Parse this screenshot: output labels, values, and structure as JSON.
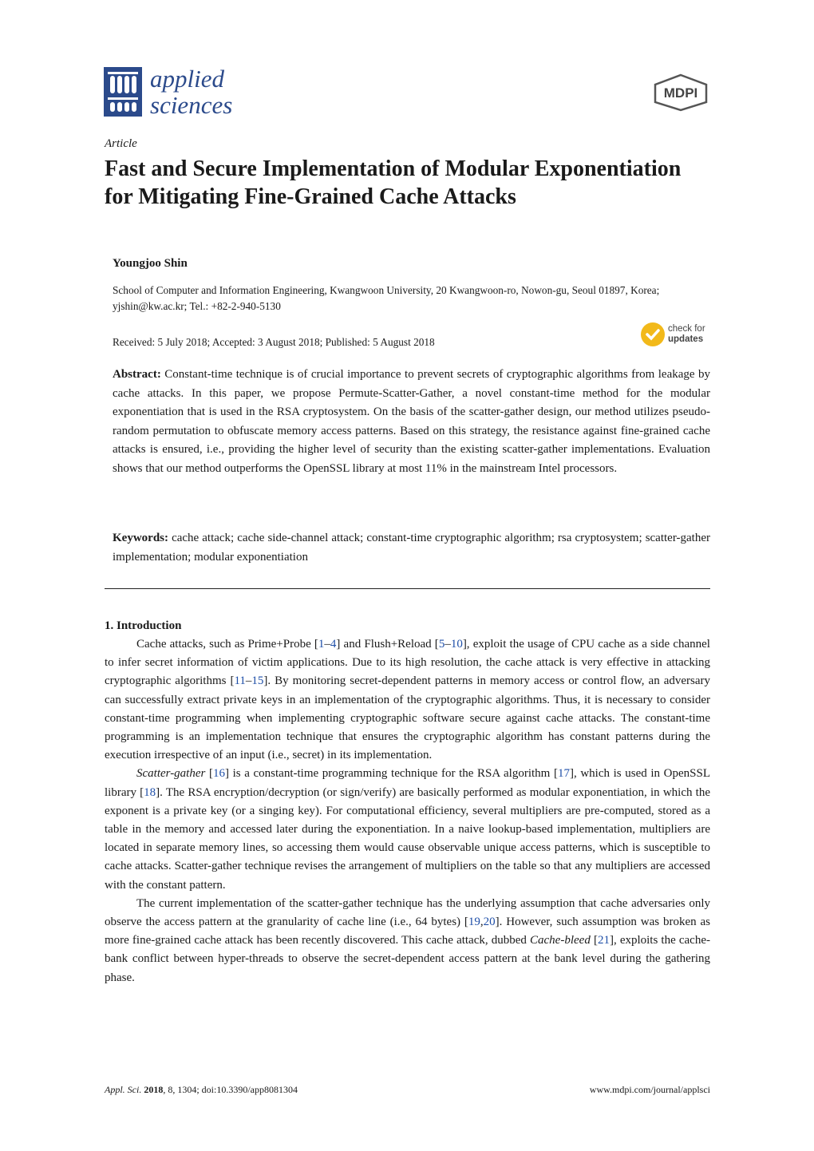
{
  "header": {
    "journal_line1": "applied",
    "journal_line2": "sciences",
    "publisher": "MDPI",
    "colors": {
      "journal_blue": "#2b4a8b",
      "link_blue": "#1f4fa8",
      "check_yellow": "#f2b91a"
    }
  },
  "article": {
    "type": "Article",
    "title": "Fast and Secure Implementation of Modular Exponentiation for Mitigating Fine-Grained Cache Attacks",
    "author": "Youngjoo Shin",
    "affiliation": "School of Computer and Information Engineering, Kwangwoon University, 20 Kwangwoon-ro, Nowon-gu, Seoul 01897, Korea; yjshin@kw.ac.kr; Tel.: +82-2-940-5130",
    "dates": "Received: 5 July 2018; Accepted: 3 August 2018; Published: 5 August 2018",
    "check_updates": {
      "line1": "check for",
      "line2": "updates"
    }
  },
  "abstract": {
    "label": "Abstract:",
    "text": "Constant-time technique is of crucial importance to prevent secrets of cryptographic algorithms from leakage by cache attacks. In this paper, we propose Permute-Scatter-Gather, a novel constant-time method for the modular exponentiation that is used in the RSA cryptosystem. On the basis of the scatter-gather design, our method utilizes pseudo-random permutation to obfuscate memory access patterns. Based on this strategy, the resistance against fine-grained cache attacks is ensured, i.e., providing the higher level of security than the existing scatter-gather implementations. Evaluation shows that our method outperforms the OpenSSL library at most 11% in the mainstream Intel processors."
  },
  "keywords": {
    "label": "Keywords:",
    "text": "cache attack; cache side-channel attack; constant-time cryptographic algorithm; rsa cryptosystem; scatter-gather implementation; modular exponentiation"
  },
  "section1": {
    "heading": "1. Introduction",
    "p1": {
      "a": "Cache attacks, such as Prime+Probe [",
      "r1": "1",
      "b": "–",
      "r2": "4",
      "c": "] and Flush+Reload [",
      "r3": "5",
      "d": "–",
      "r4": "10",
      "e": "], exploit the usage of CPU cache as a side channel to infer secret information of victim applications. Due to its high resolution, the cache attack is very effective in attacking cryptographic algorithms [",
      "r5": "11",
      "f": "–",
      "r6": "15",
      "g": "]. By monitoring secret-dependent patterns in memory access or control flow, an adversary can successfully extract private keys in an implementation of the cryptographic algorithms. Thus, it is necessary to consider constant-time programming when implementing cryptographic software secure against cache attacks. The constant-time programming is an implementation technique that ensures the cryptographic algorithm has constant patterns during the execution irrespective of an input (i.e., secret) in its implementation."
    },
    "p2": {
      "a_em": "Scatter-gather",
      "a": " [",
      "r1": "16",
      "b": "] is a constant-time programming technique for the RSA algorithm [",
      "r2": "17",
      "c": "], which is used in OpenSSL library [",
      "r3": "18",
      "d": "]. The RSA encryption/decryption (or sign/verify) are basically performed as modular exponentiation, in which the exponent is a private key (or a singing key). For computational efficiency, several multipliers are pre-computed, stored as a table in the memory and accessed later during the exponentiation. In a naive lookup-based implementation, multipliers are located in separate memory lines, so accessing them would cause observable unique access patterns, which is susceptible to cache attacks. Scatter-gather technique revises the arrangement of multipliers on the table so that any multipliers are accessed with the constant pattern."
    },
    "p3": {
      "a": "The current implementation of the scatter-gather technique has the underlying assumption that cache adversaries only observe the access pattern at the granularity of cache line (i.e., 64 bytes) [",
      "r1": "19",
      "b": ",",
      "r2": "20",
      "c": "]. However, such assumption was broken as more fine-grained cache attack has been recently discovered. This cache attack, dubbed ",
      "em": "Cache-bleed",
      "d": " [",
      "r3": "21",
      "e": "], exploits the cache-bank conflict between hyper-threads to observe the secret-dependent access pattern at the bank level during the gathering phase."
    }
  },
  "footer": {
    "journal_abbrev": "Appl. Sci.",
    "year": "2018",
    "rest": ", 8, 1304; doi:10.3390/app8081304",
    "url": "www.mdpi.com/journal/applsci"
  }
}
